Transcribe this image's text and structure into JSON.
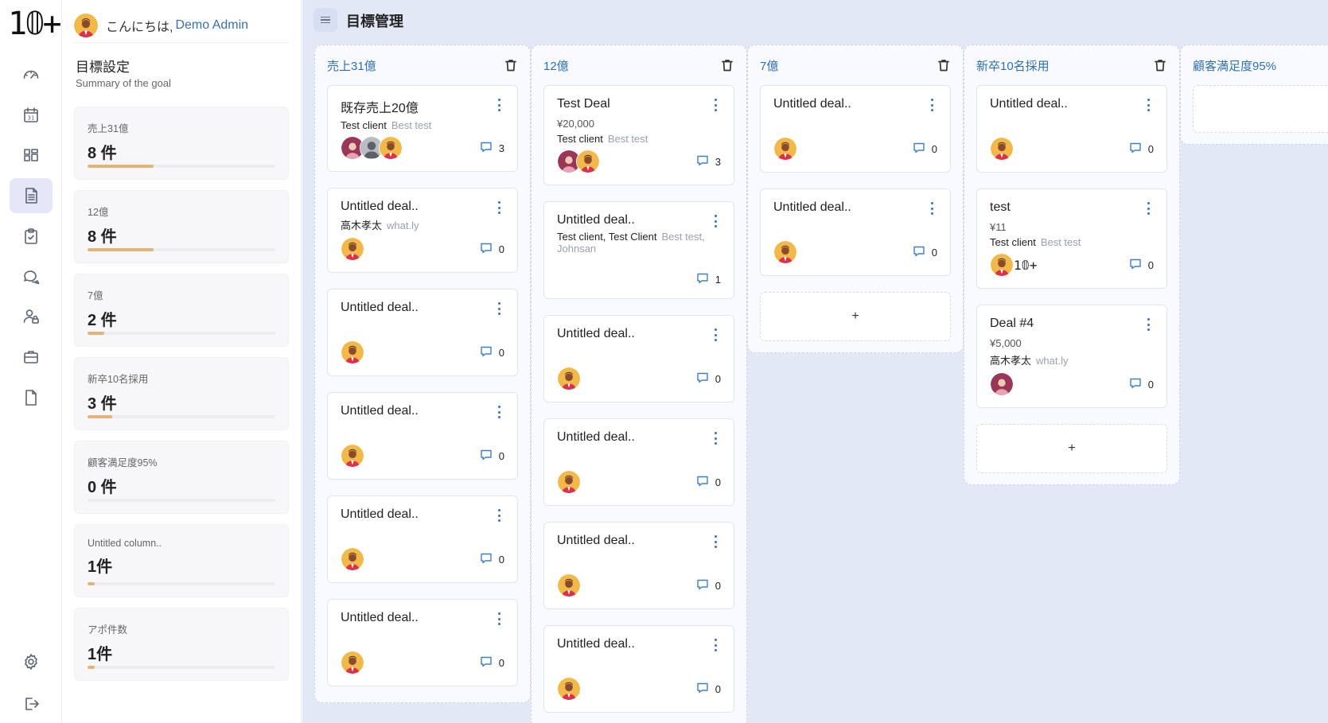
{
  "logo": "1𝟘+",
  "nav": [
    {
      "name": "dashboard-icon",
      "active": false
    },
    {
      "name": "calendar-icon",
      "active": false
    },
    {
      "name": "board-icon",
      "active": false
    },
    {
      "name": "goals-document-icon",
      "active": true
    },
    {
      "name": "checklist-icon",
      "active": false
    },
    {
      "name": "chat-icon",
      "active": false
    },
    {
      "name": "user-lock-icon",
      "active": false
    },
    {
      "name": "briefcase-icon",
      "active": false
    },
    {
      "name": "file-icon",
      "active": false
    },
    {
      "name": "settings-icon",
      "active": false
    },
    {
      "name": "logout-icon",
      "active": false
    }
  ],
  "calendar_day": "31",
  "greeting": {
    "prefix": "こんにちは,",
    "user": "Demo Admin"
  },
  "summary": {
    "title": "目標設定",
    "subtitle": "Summary of the goal",
    "goals": [
      {
        "name": "売上31億",
        "count": "8 件",
        "progress": 0.35
      },
      {
        "name": "12億",
        "count": "8 件",
        "progress": 0.35
      },
      {
        "name": "7億",
        "count": "2 件",
        "progress": 0.09
      },
      {
        "name": "新卒10名採用",
        "count": "3 件",
        "progress": 0.13
      },
      {
        "name": "顧客満足度95%",
        "count": "0 件",
        "progress": 0
      },
      {
        "name": "Untitled column..",
        "count": "1件",
        "progress": 0.04
      },
      {
        "name": "アポ件数",
        "count": "1件",
        "progress": 0.04
      }
    ]
  },
  "header": {
    "title": "目標管理"
  },
  "columns": [
    {
      "title": "売上31億",
      "deals": [
        {
          "title": "既存売上20億",
          "amount": "",
          "client": "Test client",
          "tag": "Best test",
          "avatars": [
            "woman",
            "gray",
            "man"
          ],
          "comments": "3"
        },
        {
          "title": "Untitled deal..",
          "amount": "",
          "client": "高木孝太",
          "tag": "what.ly",
          "avatars": [
            "man"
          ],
          "comments": "0"
        },
        {
          "title": "Untitled deal..",
          "amount": "",
          "client": "",
          "tag": "",
          "avatars": [
            "man"
          ],
          "comments": "0"
        },
        {
          "title": "Untitled deal..",
          "amount": "",
          "client": "",
          "tag": "",
          "avatars": [
            "man"
          ],
          "comments": "0"
        },
        {
          "title": "Untitled deal..",
          "amount": "",
          "client": "",
          "tag": "",
          "avatars": [
            "man"
          ],
          "comments": "0"
        },
        {
          "title": "Untitled deal..",
          "amount": "",
          "client": "",
          "tag": "",
          "avatars": [
            "man"
          ],
          "comments": "0"
        }
      ],
      "add": ""
    },
    {
      "title": "12億",
      "deals": [
        {
          "title": "Test Deal",
          "amount": "¥20,000",
          "client": "Test client",
          "tag": "Best test",
          "avatars": [
            "woman",
            "man"
          ],
          "comments": "3"
        },
        {
          "title": "Untitled deal..",
          "amount": "",
          "client": "Test client, Test Client",
          "tag": "Best test, Johnsan",
          "avatars": [],
          "comments": "1"
        },
        {
          "title": "Untitled deal..",
          "amount": "",
          "client": "",
          "tag": "",
          "avatars": [
            "man"
          ],
          "comments": "0"
        },
        {
          "title": "Untitled deal..",
          "amount": "",
          "client": "",
          "tag": "",
          "avatars": [
            "man"
          ],
          "comments": "0"
        },
        {
          "title": "Untitled deal..",
          "amount": "",
          "client": "",
          "tag": "",
          "avatars": [
            "man"
          ],
          "comments": "0"
        },
        {
          "title": "Untitled deal..",
          "amount": "",
          "client": "",
          "tag": "",
          "avatars": [
            "man"
          ],
          "comments": "0"
        }
      ],
      "add": ""
    },
    {
      "title": "7億",
      "deals": [
        {
          "title": "Untitled deal..",
          "amount": "",
          "client": "",
          "tag": "",
          "avatars": [
            "man"
          ],
          "comments": "0"
        },
        {
          "title": "Untitled deal..",
          "amount": "",
          "client": "",
          "tag": "",
          "avatars": [
            "man"
          ],
          "comments": "0"
        }
      ],
      "add": "+"
    },
    {
      "title": "新卒10名採用",
      "deals": [
        {
          "title": "Untitled deal..",
          "amount": "",
          "client": "",
          "tag": "",
          "avatars": [
            "man"
          ],
          "comments": "0"
        },
        {
          "title": "test",
          "amount": "¥11",
          "client": "Test client",
          "tag": "Best test",
          "avatars": [
            "man"
          ],
          "footer_logo": "1𝟘+",
          "comments": "0"
        },
        {
          "title": "Deal #4",
          "amount": "¥5,000",
          "client": "高木孝太",
          "tag": "what.ly",
          "avatars": [
            "woman"
          ],
          "comments": "0"
        }
      ],
      "add": "+"
    },
    {
      "title": "顧客満足度95%",
      "deals": [],
      "add": ""
    }
  ],
  "colors": {
    "accent": "#2f6fb0",
    "board_bg": "#e3e8f7",
    "progress": "#e2b479",
    "active_nav": "#e3e7f8"
  }
}
